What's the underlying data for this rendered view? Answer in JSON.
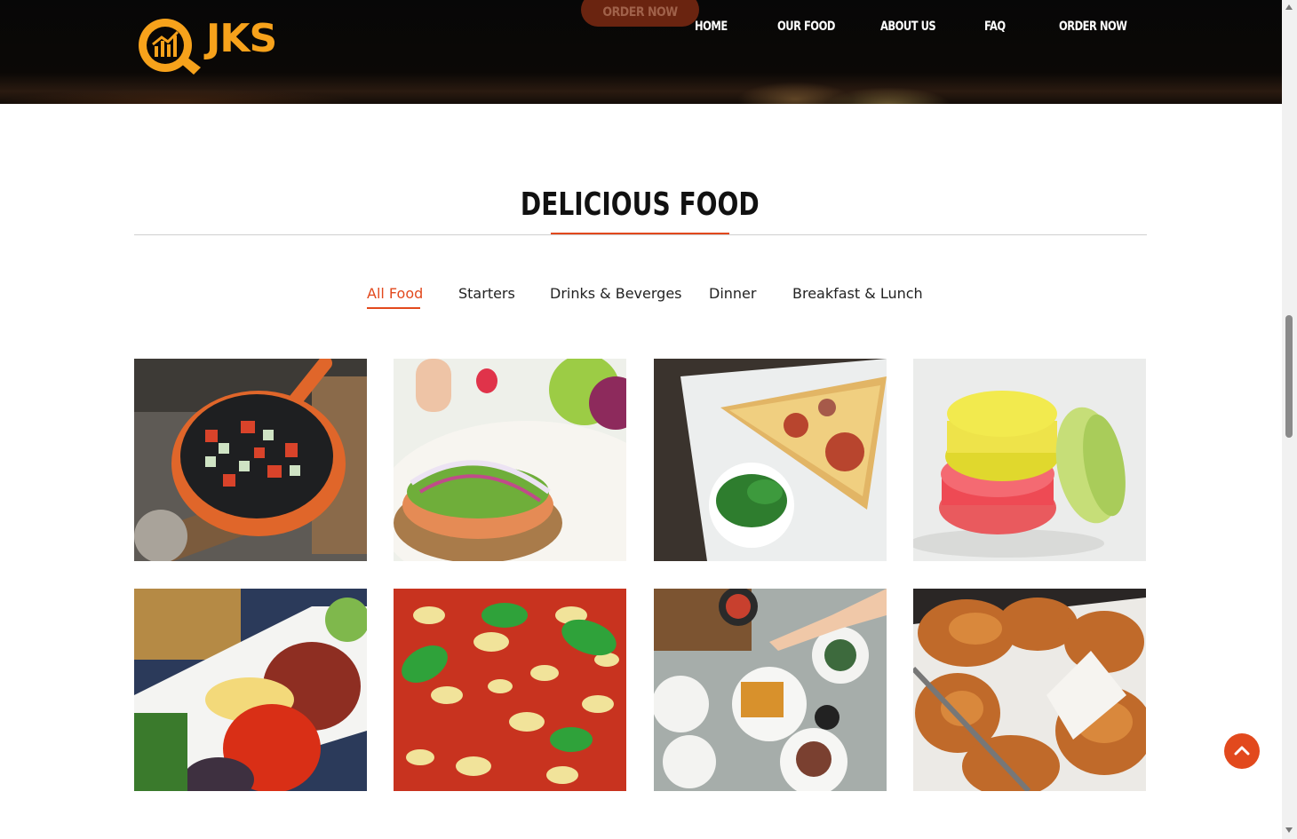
{
  "header": {
    "logo_text": "JKS",
    "order_pill": "ORDER NOW",
    "nav": [
      "HOME",
      "OUR FOOD",
      "ABOUT US",
      "FAQ",
      "ORDER NOW"
    ]
  },
  "section": {
    "title": "DELICIOUS FOOD"
  },
  "filters": {
    "items": [
      "All Food",
      "Starters",
      "Drinks & Beverges",
      "Dinner",
      "Breakfast & Lunch"
    ],
    "active": "All Food"
  },
  "colors": {
    "accent": "#e2491d",
    "logo": "#f7a21b"
  },
  "icons": {
    "scroll_top": "chevron-up-icon"
  }
}
